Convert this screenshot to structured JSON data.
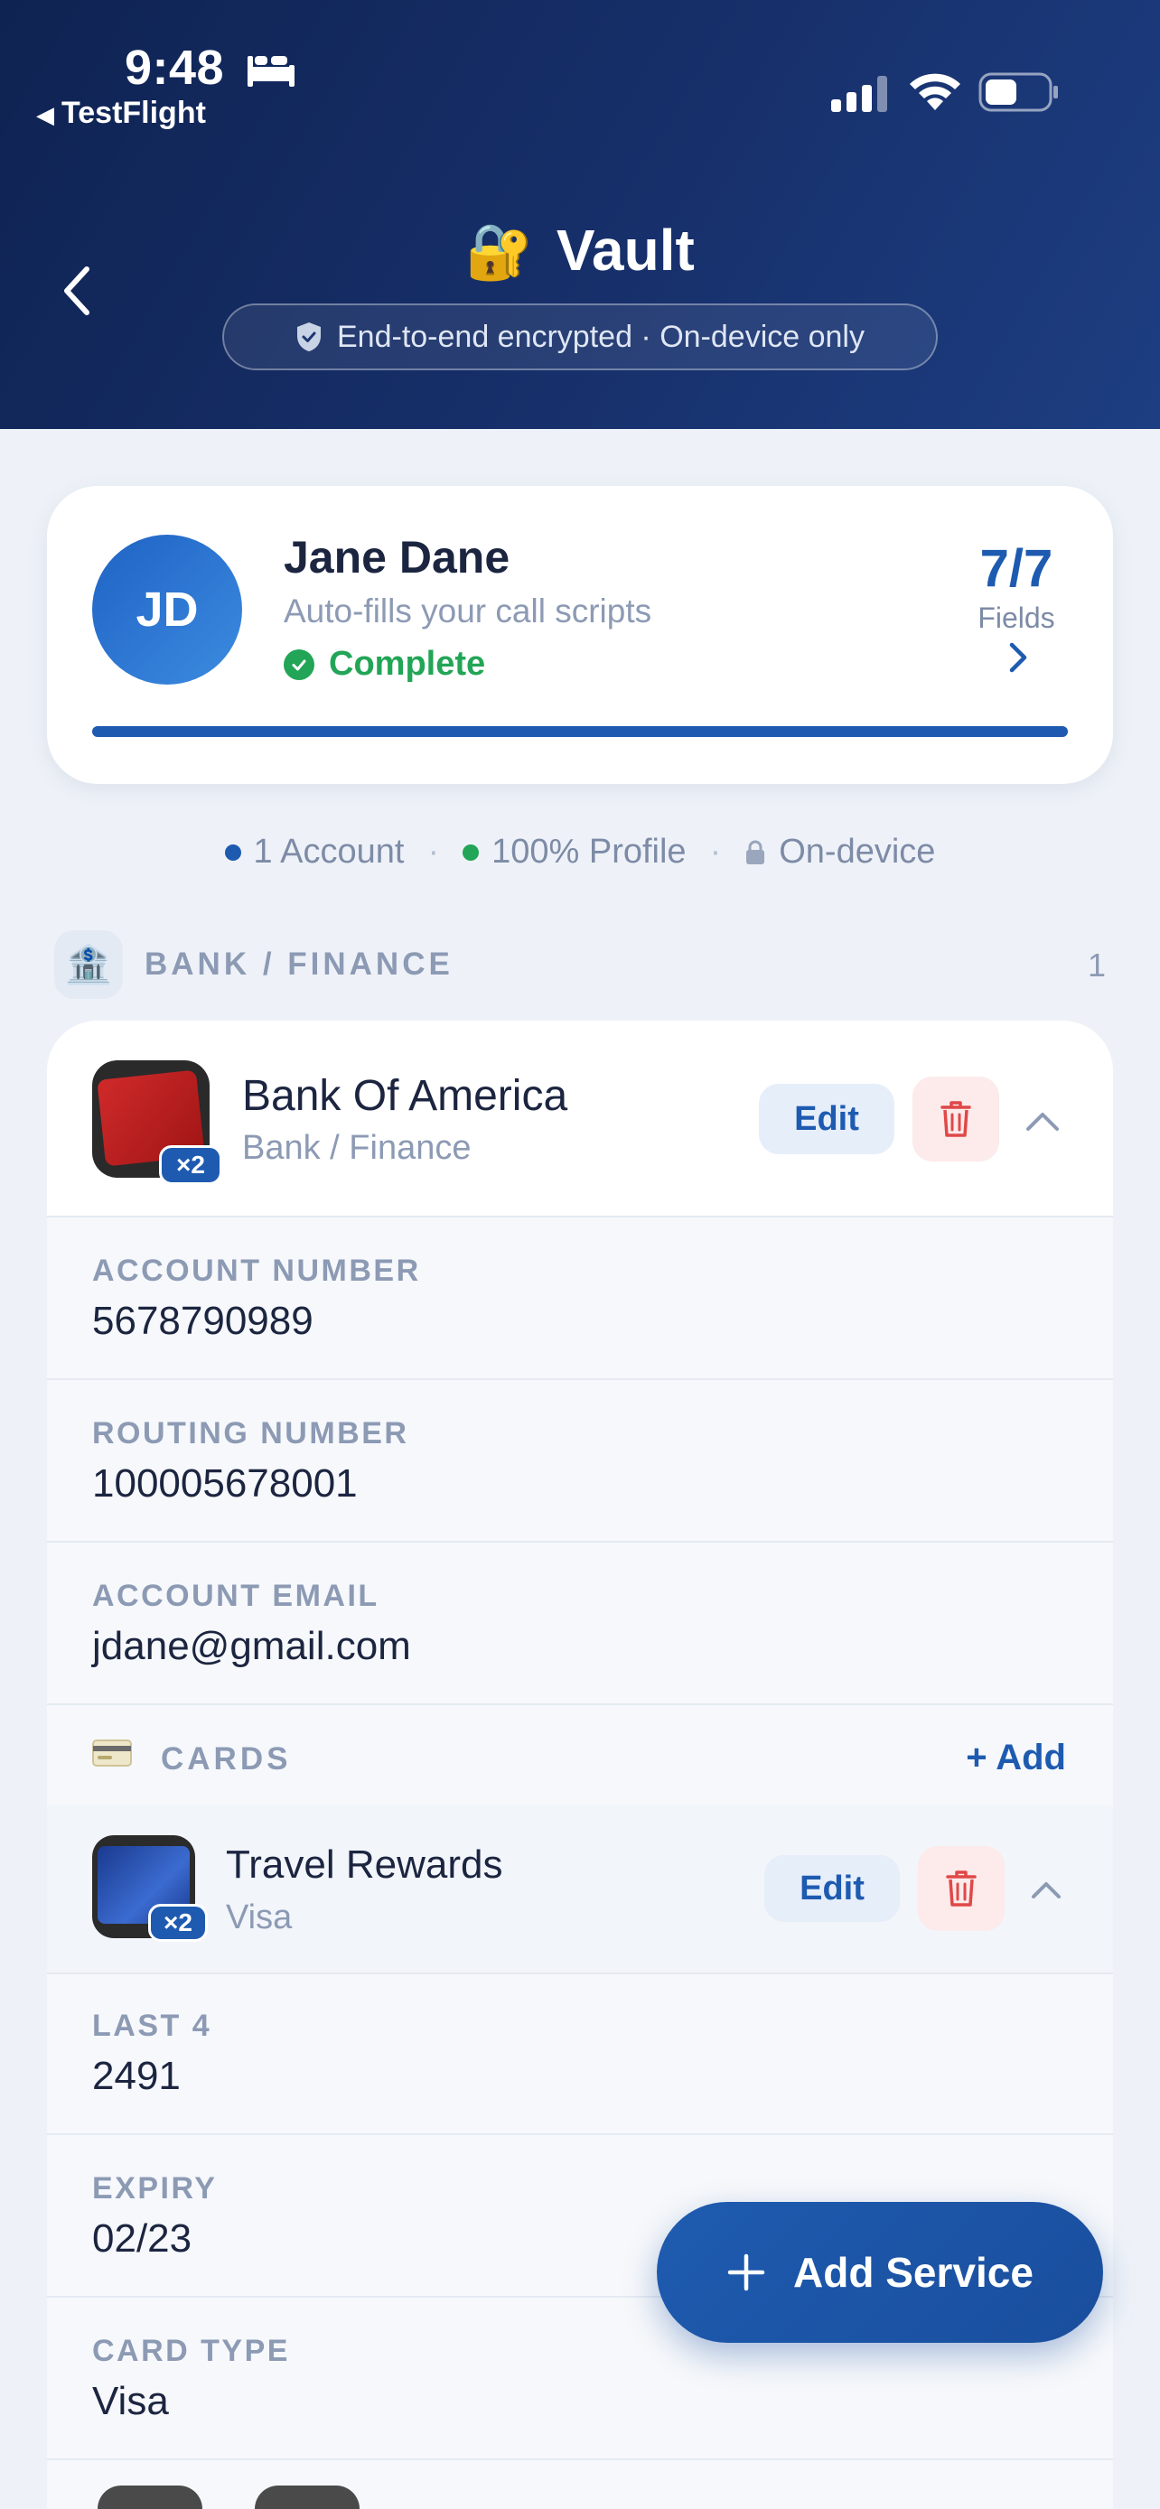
{
  "status_bar": {
    "time": "9:48",
    "back_app": "TestFlight"
  },
  "header": {
    "title": "Vault",
    "title_emoji": "🔐",
    "encryption_note": "End-to-end encrypted · On-device only"
  },
  "profile": {
    "initials": "JD",
    "name": "Jane Dane",
    "subtitle": "Auto-fills your call scripts",
    "status": "Complete",
    "count": "7/7",
    "count_label": "Fields",
    "progress": 1.0
  },
  "stats": {
    "accounts": "1 Account",
    "profile": "100% Profile",
    "storage": "On-device"
  },
  "section": {
    "emoji": "🏦",
    "label": "BANK / FINANCE",
    "count": "1"
  },
  "account": {
    "name": "Bank Of America",
    "category": "Bank / Finance",
    "badge": "×2",
    "edit_label": "Edit",
    "fields": [
      {
        "label": "ACCOUNT NUMBER",
        "value": "5678790989"
      },
      {
        "label": "ROUTING NUMBER",
        "value": "100005678001"
      },
      {
        "label": "ACCOUNT EMAIL",
        "value": "jdane@gmail.com"
      }
    ]
  },
  "cards": {
    "label": "CARDS",
    "add_label": "+ Add",
    "item": {
      "name": "Travel Rewards",
      "network": "Visa",
      "badge": "×2",
      "edit_label": "Edit",
      "fields": [
        {
          "label": "LAST 4",
          "value": "2491"
        },
        {
          "label": "EXPIRY",
          "value": "02/23"
        },
        {
          "label": "CARD TYPE",
          "value": "Visa"
        }
      ]
    }
  },
  "fab": {
    "label": "Add Service"
  },
  "colors": {
    "header_bg": "#0f2352",
    "accent": "#1e5bb0",
    "success": "#22a556",
    "danger": "#e04848",
    "page_bg": "#eef2f8"
  }
}
